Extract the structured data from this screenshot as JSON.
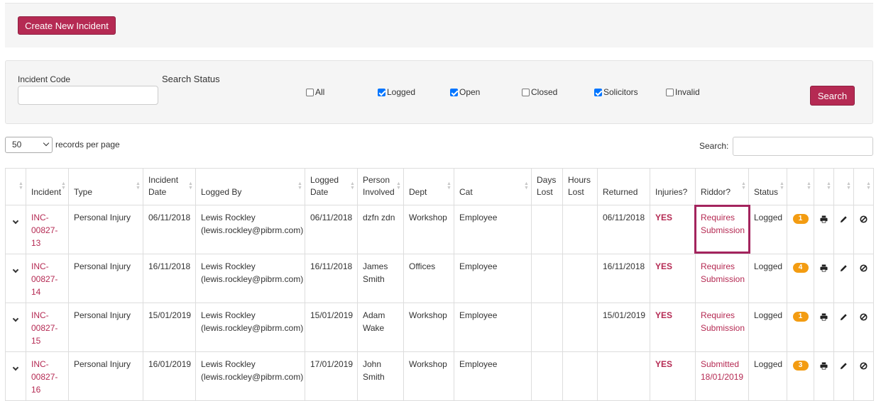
{
  "toolbar": {
    "create_label": "Create New Incident"
  },
  "search_panel": {
    "code_label": "Incident Code",
    "code_value": "",
    "status_label": "Search Status",
    "statuses": [
      {
        "label": "All",
        "checked": false
      },
      {
        "label": "Logged",
        "checked": true
      },
      {
        "label": "Open",
        "checked": true
      },
      {
        "label": "Closed",
        "checked": false
      },
      {
        "label": "Solicitors",
        "checked": true
      },
      {
        "label": "Invalid",
        "checked": false
      }
    ],
    "search_label": "Search"
  },
  "paging": {
    "page_size": "50",
    "records_label": "records per page"
  },
  "filter": {
    "label": "Search:",
    "value": ""
  },
  "table": {
    "headers": [
      "",
      "Incident",
      "Type",
      "Incident Date",
      "Logged By",
      "Logged Date",
      "Person Involved",
      "Dept",
      "Cat",
      "Days Lost",
      "Hours Lost",
      "Returned",
      "Injuries?",
      "Riddor?",
      "Status",
      "",
      "",
      "",
      ""
    ],
    "rows": [
      {
        "incident": "INC-00827-13",
        "type": "Personal Injury",
        "incident_date": "06/11/2018",
        "logged_by": "Lewis Rockley (lewis.rockley@pibrm.com)",
        "logged_date": "06/11/2018",
        "person": "dzfn zdn",
        "dept": "Workshop",
        "cat": "Employee",
        "days_lost": "",
        "hours_lost": "",
        "returned": "06/11/2018",
        "injuries": "YES",
        "riddor": "Requires Submission",
        "status": "Logged",
        "count": "1"
      },
      {
        "incident": "INC-00827-14",
        "type": "Personal Injury",
        "incident_date": "16/11/2018",
        "logged_by": "Lewis Rockley (lewis.rockley@pibrm.com)",
        "logged_date": "16/11/2018",
        "person": "James Smith",
        "dept": "Offices",
        "cat": "Employee",
        "days_lost": "",
        "hours_lost": "",
        "returned": "16/11/2018",
        "injuries": "YES",
        "riddor": "Requires Submission",
        "status": "Logged",
        "count": "4"
      },
      {
        "incident": "INC-00827-15",
        "type": "Personal Injury",
        "incident_date": "15/01/2019",
        "logged_by": "Lewis Rockley (lewis.rockley@pibrm.com)",
        "logged_date": "15/01/2019",
        "person": "Adam Wake",
        "dept": "Workshop",
        "cat": "Employee",
        "days_lost": "",
        "hours_lost": "",
        "returned": "15/01/2019",
        "injuries": "YES",
        "riddor": "Requires Submission",
        "status": "Logged",
        "count": "1"
      },
      {
        "incident": "INC-00827-16",
        "type": "Personal Injury",
        "incident_date": "16/01/2019",
        "logged_by": "Lewis Rockley (lewis.rockley@pibrm.com)",
        "logged_date": "17/01/2019",
        "person": "John Smith",
        "dept": "Workshop",
        "cat": "Employee",
        "days_lost": "",
        "hours_lost": "",
        "returned": "",
        "injuries": "YES",
        "riddor": "Submitted 18/01/2019",
        "status": "Logged",
        "count": "3"
      }
    ]
  },
  "colors": {
    "accent": "#b52a53",
    "badge": "#f39c12",
    "highlight": "#a3245d"
  },
  "icons": {
    "expand": "chevron-down-icon",
    "print": "print-icon",
    "edit": "pencil-icon",
    "invalidate": "ban-icon"
  }
}
